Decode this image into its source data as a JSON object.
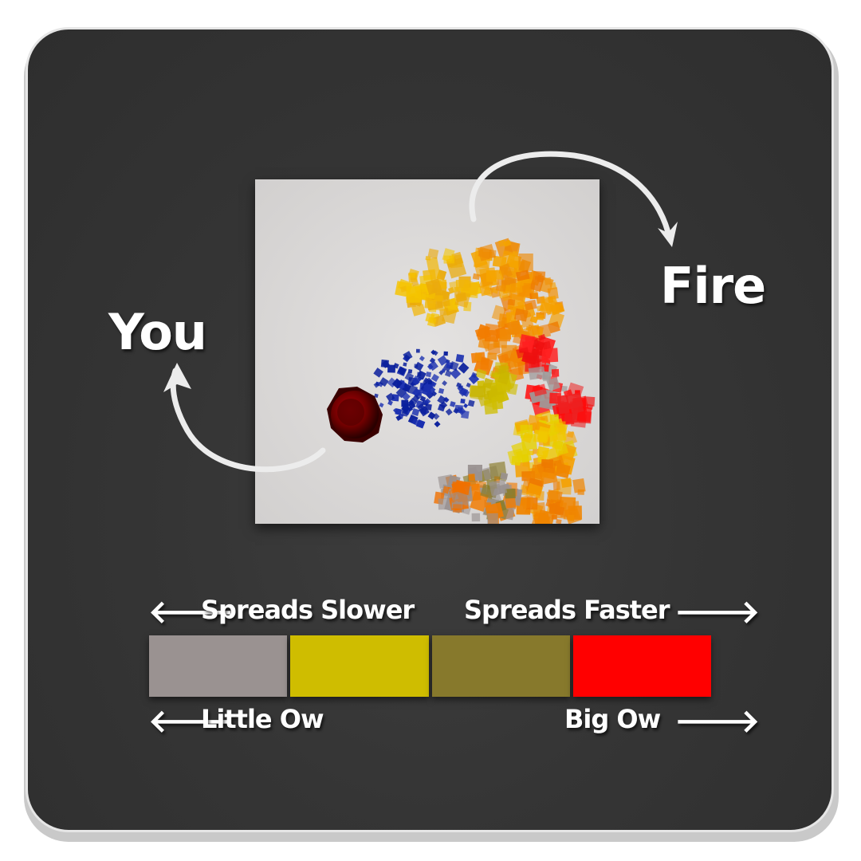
{
  "labels": {
    "you": "You",
    "fire": "Fire"
  },
  "legend": {
    "spread_slower": "Spreads Slower",
    "spread_faster": "Spreads Faster",
    "little_ow": "Little Ow",
    "big_ow": "Big Ow",
    "arrow_left": "🡐",
    "arrow_right": "🡒"
  },
  "swatches": [
    {
      "name": "gray",
      "color": "#9a9291"
    },
    {
      "name": "yellow",
      "color": "#cfbd00"
    },
    {
      "name": "olive",
      "color": "#87792c"
    },
    {
      "name": "red",
      "color": "#ff0000"
    }
  ],
  "colors": {
    "card_background": "#353535",
    "scene_background": "#dcdad9",
    "player": "#8b0000",
    "water_particles": "#0a1f9c"
  }
}
